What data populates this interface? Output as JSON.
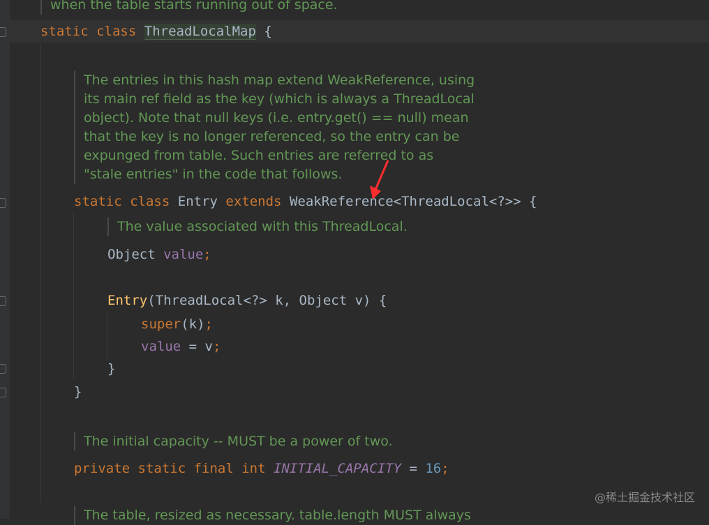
{
  "doc_top_fragment": "when the table starts running out of space.",
  "line_map": {
    "kw1": "static",
    "kw2": "class",
    "name": "ThreadLocalMap",
    "brace": "{"
  },
  "doc_entries": "The entries in this hash map extend WeakReference, using\nits main ref field as the key (which is always a ThreadLocal\nobject). Note that null keys (i.e. entry.get() == null) mean\nthat the key is no longer referenced, so the entry can be\nexpunged from table. Such entries are referred to as\n\"stale entries\" in the code that follows.",
  "line_entry": {
    "kw1": "static",
    "kw2": "class",
    "name": "Entry",
    "kw3": "extends",
    "parent": "WeakReference<ThreadLocal<?>>",
    "brace": "{"
  },
  "doc_value": "The value associated with this ThreadLocal.",
  "line_field": {
    "type": "Object",
    "name": "value",
    "semi": ";"
  },
  "line_ctor": {
    "name": "Entry",
    "params": "(ThreadLocal<?> k, Object v) {"
  },
  "line_super": {
    "kw": "super",
    "args": "(k)",
    "semi": ";"
  },
  "line_assign": {
    "field": "value",
    "rest": " = v",
    "semi": ";"
  },
  "close_inner": "}",
  "close_outer": "}",
  "doc_capacity": "The initial capacity -- MUST be a power of two.",
  "line_capacity": {
    "kw": "private static final int",
    "name": "INITIAL_CAPACITY",
    "eq": " = ",
    "value": "16",
    "semi": ";"
  },
  "doc_bottom_fragment": "The table, resized as necessary. table.length MUST always",
  "watermark": "@稀土掘金技术社区",
  "colors": {
    "keyword": "#cc7832",
    "comment": "#629755",
    "field": "#9876aa",
    "function": "#ffc66d",
    "number": "#6897bb",
    "arrow": "#ff2d2d"
  }
}
